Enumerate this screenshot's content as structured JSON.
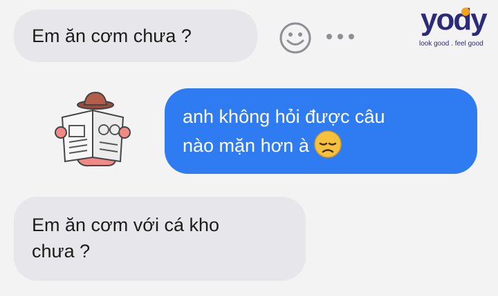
{
  "messages": [
    {
      "direction": "incoming",
      "text": "Em ăn cơm chưa ?"
    },
    {
      "direction": "outgoing",
      "lines": [
        "anh không hỏi được câu",
        "nào mặn hơn à"
      ],
      "emoji": "disappointed-face"
    },
    {
      "direction": "incoming",
      "lines": [
        "Em ăn cơm với cá kho",
        "chưa ?"
      ]
    }
  ],
  "sticker": {
    "name": "newspaper-reader-sticker"
  },
  "actions": {
    "react_icon": "smiley-icon",
    "more_icon": "more-dots-icon"
  },
  "logo": {
    "word": "yody",
    "tagline": "look good . feel good"
  },
  "colors": {
    "outgoing_bubble": "#2f7cf2",
    "incoming_bubble": "#e7e6ea",
    "logo_primary": "#2d2a7a",
    "logo_accent": "#f3a21b"
  }
}
